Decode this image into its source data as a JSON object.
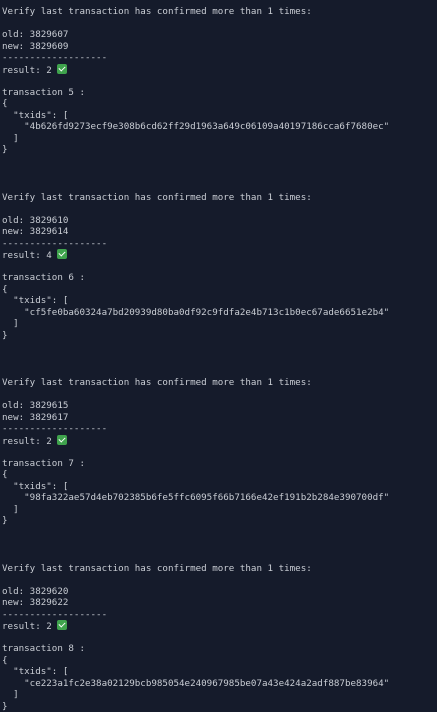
{
  "blocks": [
    {
      "header": "Verify last transaction has confirmed more than 1 times:",
      "old": "old: 3829607",
      "new": "new: 3829609",
      "divider": "-------------------",
      "result": "result: 2",
      "transaction": "transaction 5 :",
      "open_brace": "{",
      "txids_key": "  \"txids\": [",
      "txid": "    \"4b626fd9273ecf9e308b6cd62ff29d1963a649c06109a40197186cca6f7680ec\"",
      "close_bracket": "  ]",
      "close_brace": "}"
    },
    {
      "header": "Verify last transaction has confirmed more than 1 times:",
      "old": "old: 3829610",
      "new": "new: 3829614",
      "divider": "-------------------",
      "result": "result: 4",
      "transaction": "transaction 6 :",
      "open_brace": "{",
      "txids_key": "  \"txids\": [",
      "txid": "    \"cf5fe0ba60324a7bd20939d80ba0df92c9fdfa2e4b713c1b0ec67ade6651e2b4\"",
      "close_bracket": "  ]",
      "close_brace": "}"
    },
    {
      "header": "Verify last transaction has confirmed more than 1 times:",
      "old": "old: 3829615",
      "new": "new: 3829617",
      "divider": "-------------------",
      "result": "result: 2",
      "transaction": "transaction 7 :",
      "open_brace": "{",
      "txids_key": "  \"txids\": [",
      "txid": "    \"98fa322ae57d4eb702385b6fe5ffc6095f66b7166e42ef191b2b284e390700df\"",
      "close_bracket": "  ]",
      "close_brace": "}"
    },
    {
      "header": "Verify last transaction has confirmed more than 1 times:",
      "old": "old: 3829620",
      "new": "new: 3829622",
      "divider": "-------------------",
      "result": "result: 2",
      "transaction": "transaction 8 :",
      "open_brace": "{",
      "txids_key": "  \"txids\": [",
      "txid": "    \"ce223a1fc2e38a02129bcb985054e240967985be07a43e424a2adf887be83964\"",
      "close_bracket": "  ]",
      "close_brace": "}"
    }
  ],
  "check_icon_color": "#3fa34d",
  "background_color": "#151b2b",
  "text_color": "#c9cdd4"
}
